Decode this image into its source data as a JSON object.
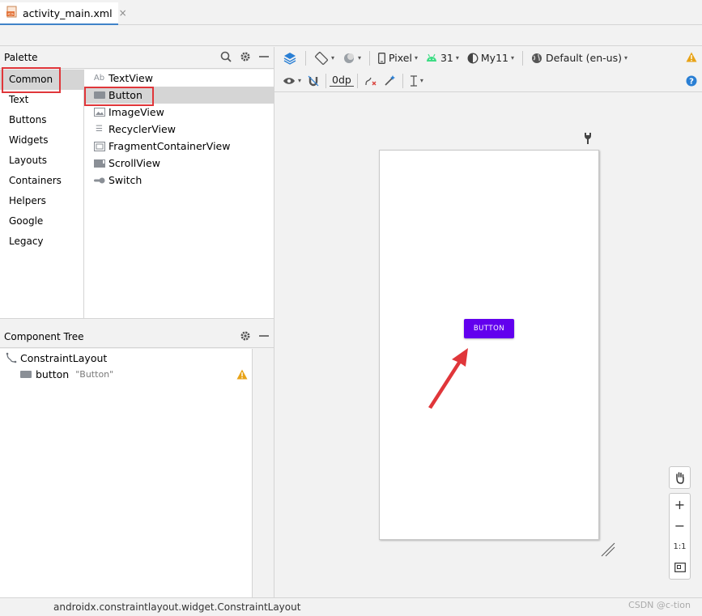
{
  "file_tab": {
    "name": "activity_main.xml",
    "close": "×"
  },
  "palette": {
    "title": "Palette",
    "categories": [
      "Common",
      "Text",
      "Buttons",
      "Widgets",
      "Layouts",
      "Containers",
      "Helpers",
      "Google",
      "Legacy"
    ],
    "selected_category": "Common",
    "items": [
      {
        "label": "TextView",
        "icon": "text-view-icon",
        "glyph": "Ab"
      },
      {
        "label": "Button",
        "icon": "button-widget-icon",
        "glyph": ""
      },
      {
        "label": "ImageView",
        "icon": "image-view-icon",
        "glyph": ""
      },
      {
        "label": "RecyclerView",
        "icon": "recycler-view-icon",
        "glyph": "☰"
      },
      {
        "label": "FragmentContainerView",
        "icon": "fragment-container-icon",
        "glyph": ""
      },
      {
        "label": "ScrollView",
        "icon": "scroll-view-icon",
        "glyph": ""
      },
      {
        "label": "Switch",
        "icon": "switch-icon",
        "glyph": ""
      }
    ],
    "selected_item": "Button"
  },
  "component_tree": {
    "title": "Component Tree",
    "root": "ConstraintLayout",
    "child_id": "button",
    "child_text": "\"Button\""
  },
  "toolbar": {
    "device": "Pixel",
    "api_level": "31",
    "theme": "My11",
    "locale": "Default (en-us)",
    "margin": "0dp"
  },
  "preview": {
    "button_text": "BUTTON"
  },
  "zoom": {
    "plus": "+",
    "minus": "−",
    "one_to_one": "1:1"
  },
  "status": {
    "path": "androidx.constraintlayout.widget.ConstraintLayout"
  },
  "watermark": "CSDN @c-tion",
  "colors": {
    "button_purple": "#6200ee",
    "warning": "#e8a317",
    "highlight_red": "#e0363a",
    "android_green": "#3ddc84",
    "help_blue": "#2a7fd4",
    "tab_underline": "#4083c9"
  }
}
